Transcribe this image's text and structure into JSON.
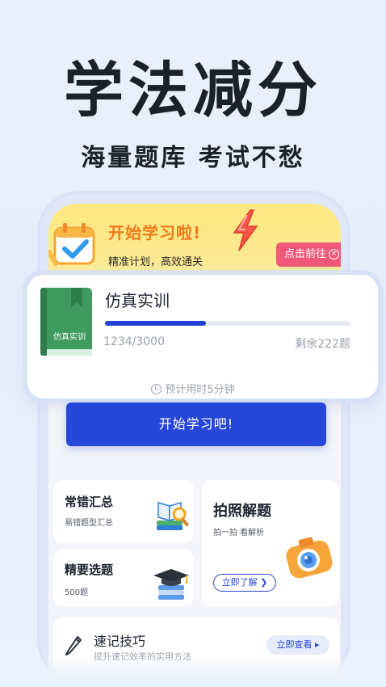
{
  "hero": {
    "title": "学法减分",
    "subtitle": "海量题库  考试不愁"
  },
  "banner": {
    "title": "开始学习啦!",
    "subtitle": "精准计划，高效通关",
    "button_label": "点击前往",
    "button_close_glyph": "×"
  },
  "course_card": {
    "book_label": "仿真实训",
    "title": "仿真实训",
    "done": 1234,
    "total": 3000,
    "count_text": "1234/3000",
    "remaining_text": "剩余222题",
    "progress_fraction": 0.411
  },
  "estimate_text": "预计用时5分钟",
  "start_button": "开始学习吧!",
  "tiles": {
    "mistakes": {
      "title": "常错汇总",
      "subtitle": "易错题型汇总"
    },
    "photo": {
      "title": "拍照解题",
      "subtitle": "拍一拍 看解析",
      "button": "立即了解 ❯"
    },
    "selected": {
      "title": "精要选题",
      "subtitle": "500题"
    }
  },
  "shortcut": {
    "title": "速记技巧",
    "subtitle": "提升速记效率的实用方法",
    "button": "立即查看 ▸"
  },
  "colors": {
    "accent": "#2747d8",
    "banner_title": "#f07a1a",
    "banner_button": "#f2587a",
    "book_green": "#3f9a5e"
  },
  "icons": [
    "calendar-check-icon",
    "lightning-icon",
    "book-icon",
    "clock-icon",
    "magnifier-book-icon",
    "camera-icon",
    "graduation-cap-icon",
    "pencil-icon"
  ]
}
